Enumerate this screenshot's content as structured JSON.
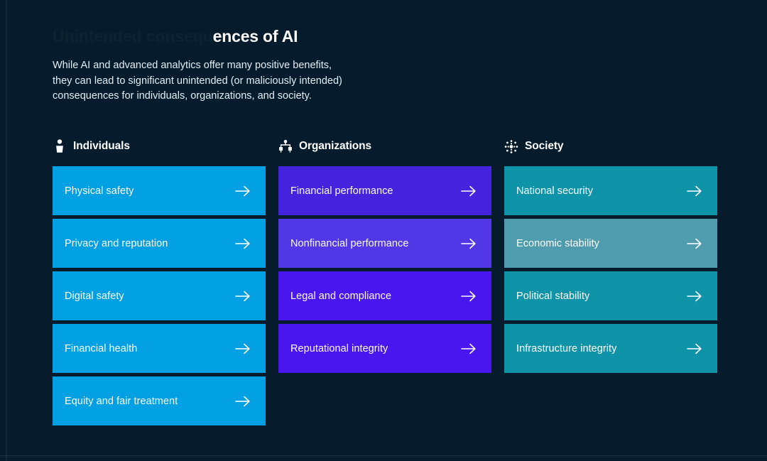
{
  "slide": {
    "background_color": "#061c2c",
    "title_ghost_prefix": "Unintended consequ",
    "title_visible": "ences of AI",
    "subtitle_lines": [
      "While AI and advanced analytics offer many positive benefits,",
      "they can lead to significant unintended (or maliciously intended)",
      "consequences for individuals, organizations, and society."
    ]
  },
  "columns": [
    {
      "key": "individuals",
      "title": "Individuals",
      "icon": "person-icon",
      "accent": "#009fe3",
      "cards": [
        {
          "label": "Physical safety",
          "color": "#00a0e3",
          "arrow": "arrow-right-icon"
        },
        {
          "label": "Privacy and reputation",
          "color": "#00a0e3",
          "arrow": "arrow-right-icon"
        },
        {
          "label": "Digital safety",
          "color": "#00a0e3",
          "arrow": "arrow-right-icon"
        },
        {
          "label": "Financial health",
          "color": "#00a0e3",
          "arrow": "arrow-right-icon"
        },
        {
          "label": "Equity and fair treatment",
          "color": "#00a0e3",
          "arrow": "arrow-right-icon"
        }
      ]
    },
    {
      "key": "organizations",
      "title": "Organizations",
      "icon": "org-chart-icon",
      "accent": "#4a1fe8",
      "cards": [
        {
          "label": "Financial performance",
          "color": "#4323dd",
          "arrow": "arrow-right-icon"
        },
        {
          "label": "Nonfinancial performance",
          "color": "#5237e6",
          "arrow": "arrow-right-icon"
        },
        {
          "label": "Legal and compliance",
          "color": "#4a16f0",
          "arrow": "arrow-right-icon"
        },
        {
          "label": "Reputational integrity",
          "color": "#4a16f0",
          "arrow": "arrow-right-icon"
        }
      ]
    },
    {
      "key": "society",
      "title": "Society",
      "icon": "network-dots-icon",
      "accent": "#0f93a9",
      "cards": [
        {
          "label": "National security",
          "color": "#0f93a9",
          "arrow": "arrow-right-icon"
        },
        {
          "label": "Economic stability",
          "color": "#4e9cae",
          "arrow": "arrow-right-icon"
        },
        {
          "label": "Political stability",
          "color": "#0f93a9",
          "arrow": "arrow-right-icon"
        },
        {
          "label": "Infrastructure integrity",
          "color": "#0f93a9",
          "arrow": "arrow-right-icon"
        }
      ]
    }
  ]
}
